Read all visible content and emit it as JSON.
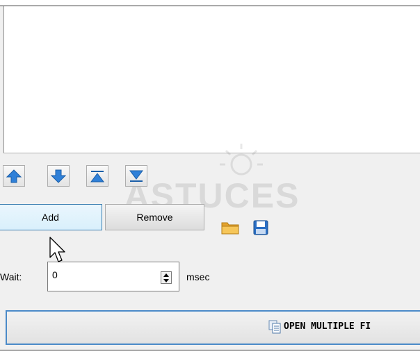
{
  "toolbar": {
    "move_buttons": [
      {
        "name": "move-up-button",
        "icon": "arrow-up-icon"
      },
      {
        "name": "move-down-button",
        "icon": "arrow-down-icon"
      },
      {
        "name": "move-top-button",
        "icon": "move-to-top-icon"
      },
      {
        "name": "move-bottom-button",
        "icon": "move-to-bottom-icon"
      }
    ],
    "add_label": "Add",
    "remove_label": "Remove",
    "open_folder_icon": "folder-icon",
    "save_icon": "save-icon"
  },
  "wait": {
    "label": "Wait:",
    "value": "0",
    "unit": "msec"
  },
  "open_multiple": {
    "label": "OPEN MULTIPLE FI",
    "icon": "pages-icon"
  },
  "watermark": {
    "text": "ASTUCES"
  },
  "colors": {
    "accent": "#3c7fb1",
    "arrow_blue": "#2f80d8",
    "focus_border": "#4a8ac8",
    "folder": "#f0b43c"
  }
}
